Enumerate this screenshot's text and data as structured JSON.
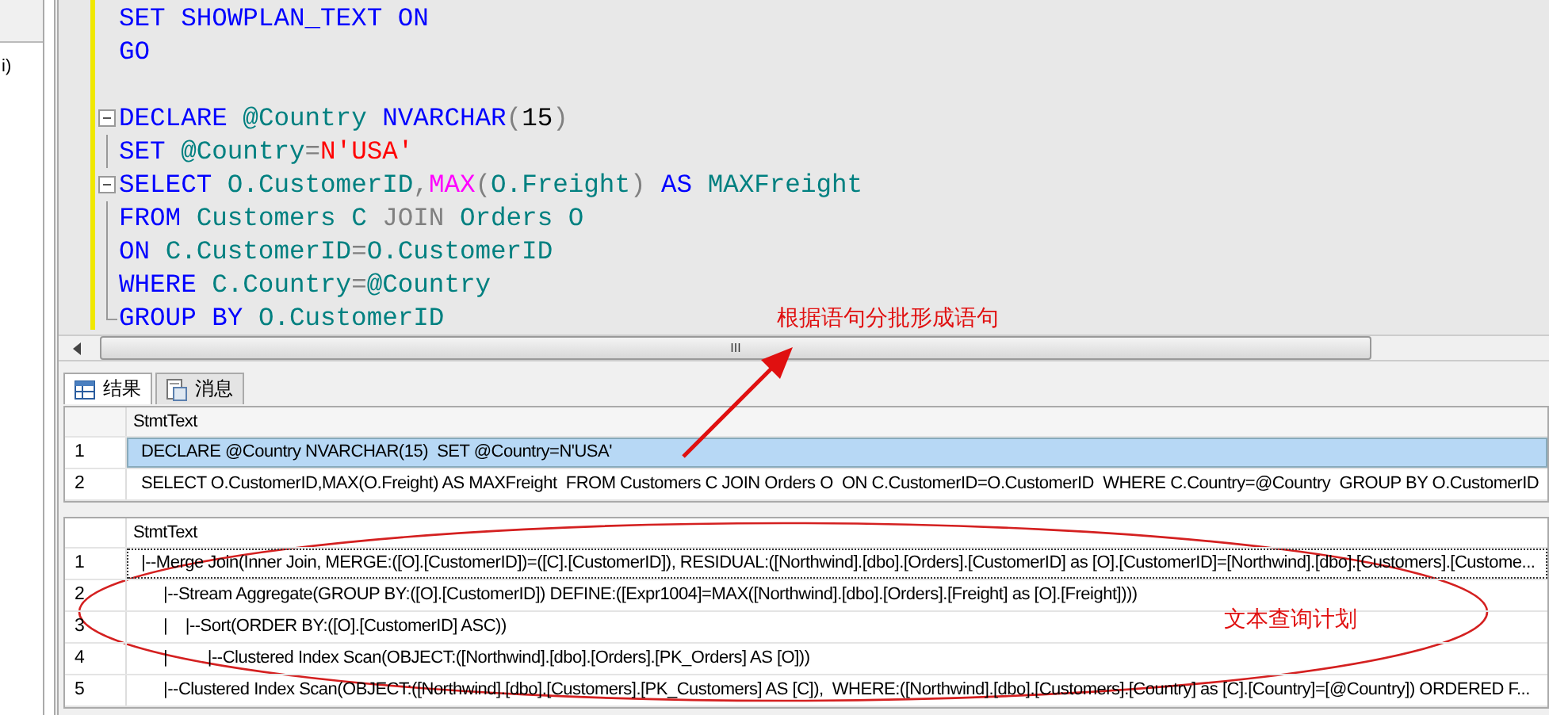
{
  "side_panel": {
    "text": "i)"
  },
  "editor": {
    "lines": [
      {
        "kind": "plain",
        "tokens": [
          {
            "text": "SET SHOWPLAN_TEXT ON",
            "kind": "keyword"
          }
        ]
      },
      {
        "kind": "plain",
        "tokens": [
          {
            "text": "GO",
            "kind": "keyword"
          }
        ]
      },
      {
        "kind": "blank"
      },
      {
        "kind": "fold_start",
        "tokens": [
          {
            "text": "DECLARE ",
            "kind": "keyword"
          },
          {
            "text": "@Country ",
            "kind": "identifier"
          },
          {
            "text": "NVARCHAR",
            "kind": "keyword"
          },
          {
            "text": "(",
            "kind": "operator"
          },
          {
            "text": "15",
            "kind": "number"
          },
          {
            "text": ")",
            "kind": "operator"
          }
        ]
      },
      {
        "kind": "fold_line",
        "tokens": [
          {
            "text": "SET ",
            "kind": "keyword"
          },
          {
            "text": "@Country",
            "kind": "identifier"
          },
          {
            "text": "=",
            "kind": "operator"
          },
          {
            "text": "N'USA'",
            "kind": "string"
          }
        ]
      },
      {
        "kind": "fold_start",
        "tokens": [
          {
            "text": "SELECT ",
            "kind": "keyword"
          },
          {
            "text": "O.CustomerID",
            "kind": "identifier"
          },
          {
            "text": ",",
            "kind": "operator"
          },
          {
            "text": "MAX",
            "kind": "function"
          },
          {
            "text": "(",
            "kind": "operator"
          },
          {
            "text": "O.Freight",
            "kind": "identifier"
          },
          {
            "text": ") ",
            "kind": "operator"
          },
          {
            "text": "AS ",
            "kind": "keyword"
          },
          {
            "text": "MAXFreight",
            "kind": "identifier"
          }
        ]
      },
      {
        "kind": "fold_line",
        "tokens": [
          {
            "text": "FROM ",
            "kind": "keyword"
          },
          {
            "text": "Customers C ",
            "kind": "identifier"
          },
          {
            "text": "JOIN ",
            "kind": "operator"
          },
          {
            "text": "Orders O",
            "kind": "identifier"
          }
        ]
      },
      {
        "kind": "fold_line",
        "tokens": [
          {
            "text": "ON ",
            "kind": "keyword"
          },
          {
            "text": "C.CustomerID",
            "kind": "identifier"
          },
          {
            "text": "=",
            "kind": "operator"
          },
          {
            "text": "O.CustomerID",
            "kind": "identifier"
          }
        ]
      },
      {
        "kind": "fold_line",
        "tokens": [
          {
            "text": "WHERE ",
            "kind": "keyword"
          },
          {
            "text": "C.Country",
            "kind": "identifier"
          },
          {
            "text": "=",
            "kind": "operator"
          },
          {
            "text": "@Country",
            "kind": "identifier"
          }
        ]
      },
      {
        "kind": "fold_end",
        "tokens": [
          {
            "text": "GROUP BY ",
            "kind": "keyword"
          },
          {
            "text": "O.CustomerID",
            "kind": "identifier"
          }
        ]
      }
    ],
    "scroll_grip": "III"
  },
  "tabs": [
    {
      "label": "结果",
      "selected": true
    },
    {
      "label": "消息",
      "selected": false
    }
  ],
  "grids": [
    {
      "column": "StmtText",
      "rows": [
        {
          "number": "1",
          "text": "DECLARE @Country NVARCHAR(15)  SET @Country=N'USA'",
          "selected": true
        },
        {
          "number": "2",
          "text": "SELECT O.CustomerID,MAX(O.Freight) AS MAXFreight  FROM Customers C JOIN Orders O  ON C.CustomerID=O.CustomerID  WHERE C.Country=@Country  GROUP BY O.CustomerID",
          "selected": false
        }
      ]
    },
    {
      "column": "StmtText",
      "rows": [
        {
          "number": "1",
          "text": "|--Merge Join(Inner Join, MERGE:([O].[CustomerID])=([C].[CustomerID]), RESIDUAL:([Northwind].[dbo].[Orders].[CustomerID] as [O].[CustomerID]=[Northwind].[dbo].[Customers].[Custome...",
          "focused": true
        },
        {
          "number": "2",
          "text": "     |--Stream Aggregate(GROUP BY:([O].[CustomerID]) DEFINE:([Expr1004]=MAX([Northwind].[dbo].[Orders].[Freight] as [O].[Freight])))",
          "focused": false
        },
        {
          "number": "3",
          "text": "     |    |--Sort(ORDER BY:([O].[CustomerID] ASC))",
          "focused": false
        },
        {
          "number": "4",
          "text": "     |         |--Clustered Index Scan(OBJECT:([Northwind].[dbo].[Orders].[PK_Orders] AS [O]))",
          "focused": false
        },
        {
          "number": "5",
          "text": "     |--Clustered Index Scan(OBJECT:([Northwind].[dbo].[Customers].[PK_Customers] AS [C]),  WHERE:([Northwind].[dbo].[Customers].[Country] as [C].[Country]=[@Country]) ORDERED F...",
          "focused": false
        }
      ]
    }
  ],
  "annotations": [
    {
      "text": "根据语句分批形成语句",
      "kind": "arrow"
    },
    {
      "text": "文本查询计划",
      "kind": "ellipse"
    }
  ]
}
